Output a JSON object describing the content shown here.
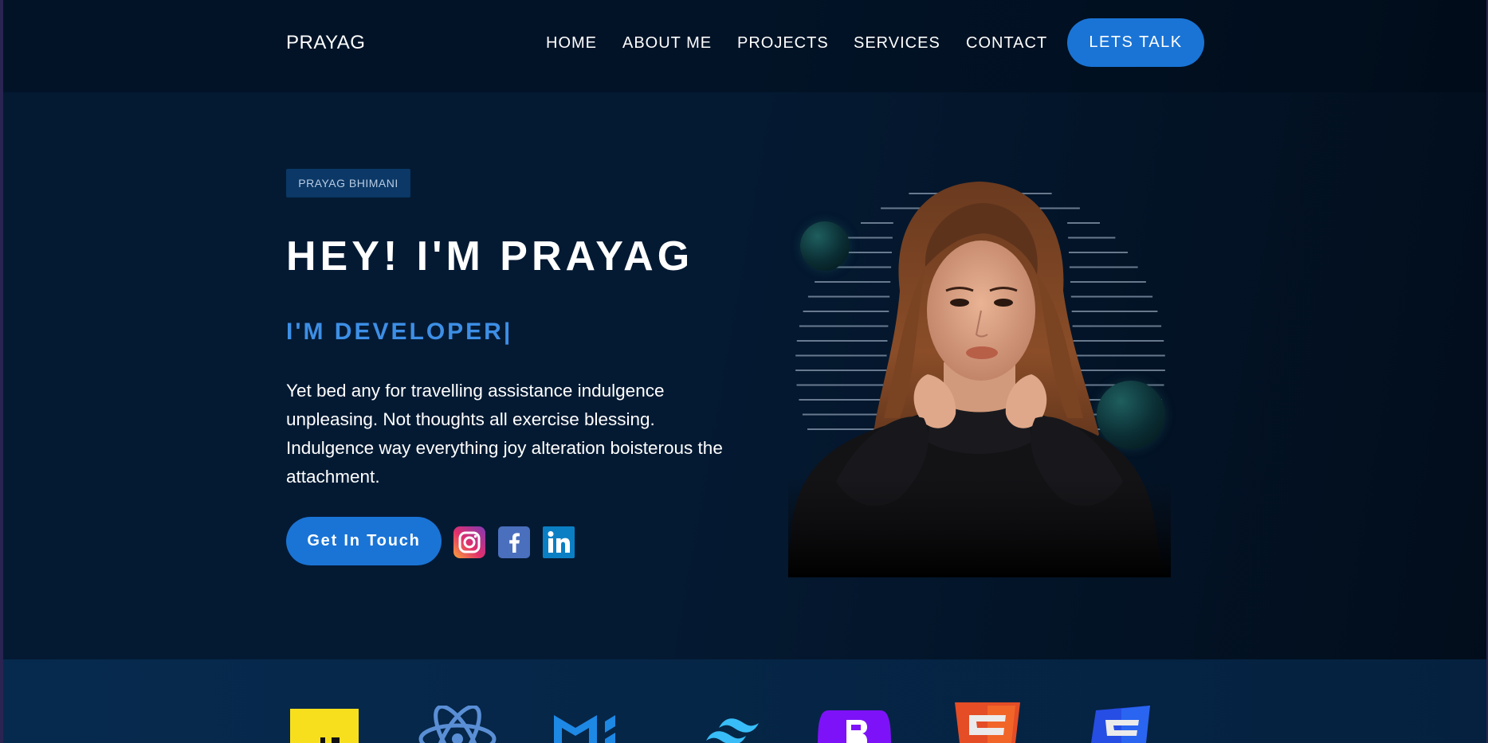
{
  "nav": {
    "logo": "PRAYAG",
    "items": [
      {
        "label": "HOME"
      },
      {
        "label": "ABOUT ME"
      },
      {
        "label": "PROJECTS"
      },
      {
        "label": "SERVICES"
      },
      {
        "label": "CONTACT"
      }
    ],
    "cta_label": "LETS TALK"
  },
  "hero": {
    "badge": "PRAYAG BHIMANI",
    "title": "HEY! I'M PRAYAG",
    "subtitle": "I'M DEVELOPER|",
    "description": "Yet bed any for travelling assistance indulgence unpleasing. Not thoughts all exercise blessing. Indulgence way everything joy alteration boisterous the attachment.",
    "cta_label": "Get In Touch",
    "socials": [
      {
        "icon": "instagram-icon"
      },
      {
        "icon": "facebook-icon"
      },
      {
        "icon": "linkedin-icon"
      }
    ]
  },
  "tech_logos": [
    {
      "icon": "javascript-icon",
      "color": "#f7df1e"
    },
    {
      "icon": "react-icon",
      "color": "#5a8fd6"
    },
    {
      "icon": "material-ui-icon",
      "color": "#1e88e5"
    },
    {
      "icon": "tailwind-icon",
      "color": "#38bdf8"
    },
    {
      "icon": "bootstrap-icon",
      "color": "#7d12f8"
    },
    {
      "icon": "html5-icon",
      "color": "#e44d26"
    },
    {
      "icon": "css3-icon",
      "color": "#264de4"
    }
  ],
  "colors": {
    "accent": "#1a74d6",
    "subtitle": "#3d8fe6",
    "background": "#041a33"
  }
}
